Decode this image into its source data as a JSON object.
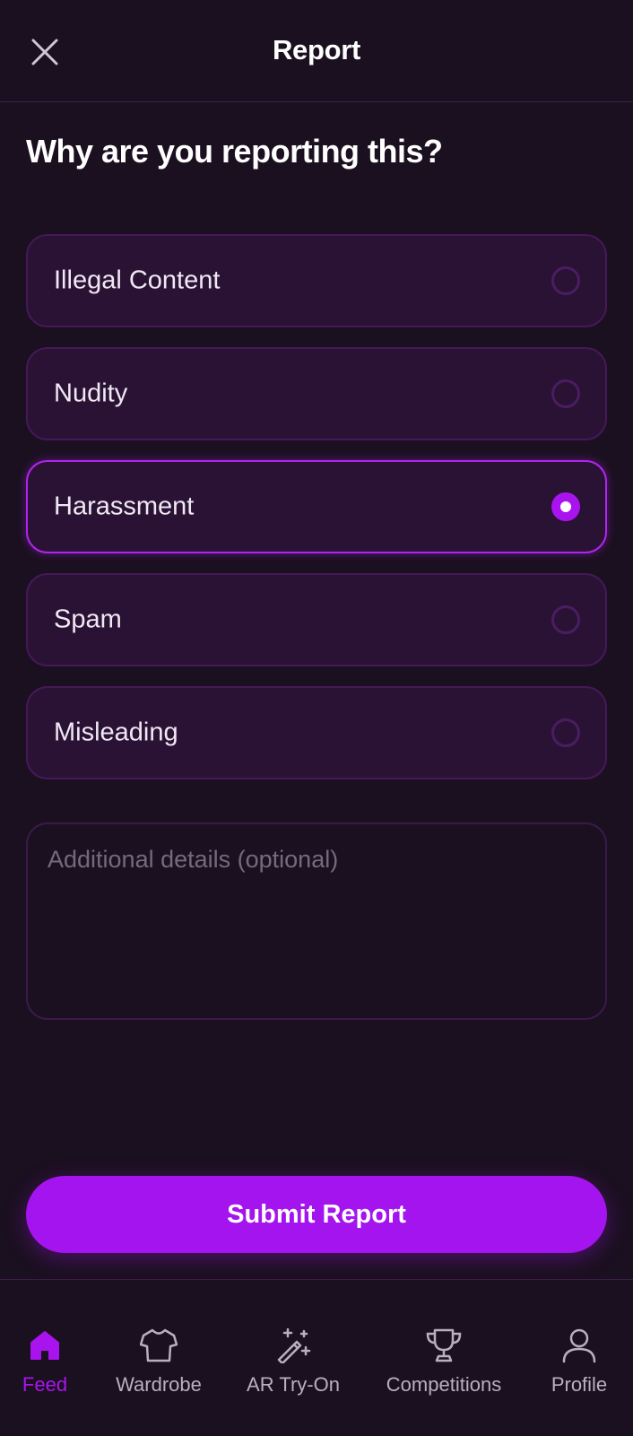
{
  "header": {
    "title": "Report",
    "close_icon": "close-icon"
  },
  "question": "Why are you reporting this?",
  "options": [
    {
      "label": "Illegal Content",
      "selected": false
    },
    {
      "label": "Nudity",
      "selected": false
    },
    {
      "label": "Harassment",
      "selected": true
    },
    {
      "label": "Spam",
      "selected": false
    },
    {
      "label": "Misleading",
      "selected": false
    }
  ],
  "details": {
    "placeholder": "Additional details (optional)",
    "value": ""
  },
  "submit_label": "Submit Report",
  "nav": {
    "items": [
      {
        "label": "Feed",
        "icon": "home-icon",
        "active": true
      },
      {
        "label": "Wardrobe",
        "icon": "shirt-icon",
        "active": false
      },
      {
        "label": "AR Try-On",
        "icon": "magic-wand-icon",
        "active": false
      },
      {
        "label": "Competitions",
        "icon": "trophy-icon",
        "active": false
      },
      {
        "label": "Profile",
        "icon": "user-icon",
        "active": false
      }
    ]
  },
  "colors": {
    "background": "#1b1020",
    "accent": "#a914ee",
    "card": "#2a1234"
  }
}
